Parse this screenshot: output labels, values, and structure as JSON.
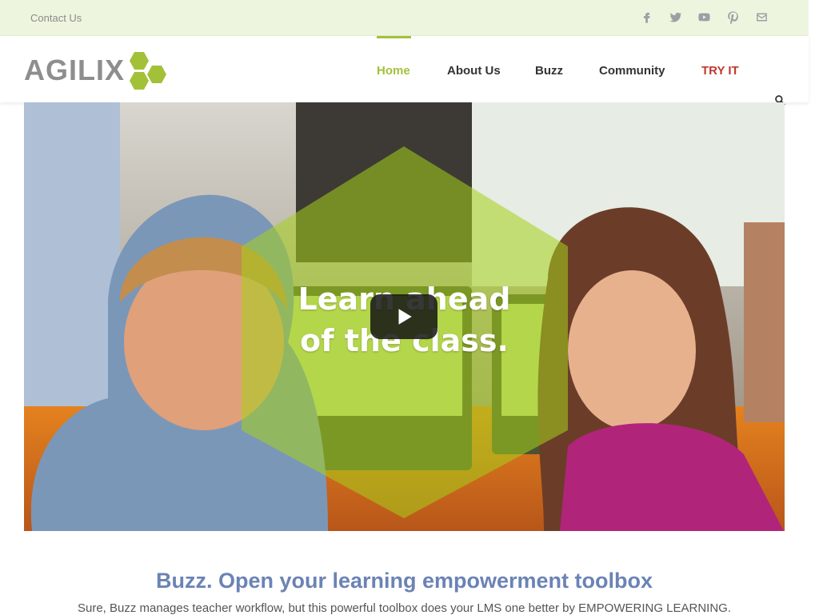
{
  "topbar": {
    "contact_label": "Contact Us",
    "social": [
      "facebook-icon",
      "twitter-icon",
      "youtube-icon",
      "pinterest-icon",
      "mail-icon"
    ]
  },
  "logo": {
    "text": "AGILIX"
  },
  "nav": {
    "items": [
      {
        "label": "Home",
        "active": true
      },
      {
        "label": "About Us"
      },
      {
        "label": "Buzz"
      },
      {
        "label": "Community"
      },
      {
        "label": "TRY IT",
        "accent": "#c0392b"
      }
    ],
    "search_icon": "search-icon"
  },
  "hero": {
    "title_line1": "Learn ahead",
    "title_line2": "of the class.",
    "play_icon": "play-icon"
  },
  "section": {
    "title": "Buzz. Open your learning empowerment toolbox",
    "text": "Sure, Buzz manages teacher workflow, but this powerful toolbox does your LMS one better by EMPOWERING LEARNING."
  },
  "colors": {
    "accent_green": "#a2c139",
    "title_blue": "#6b83b5",
    "try_red": "#c0392b"
  }
}
